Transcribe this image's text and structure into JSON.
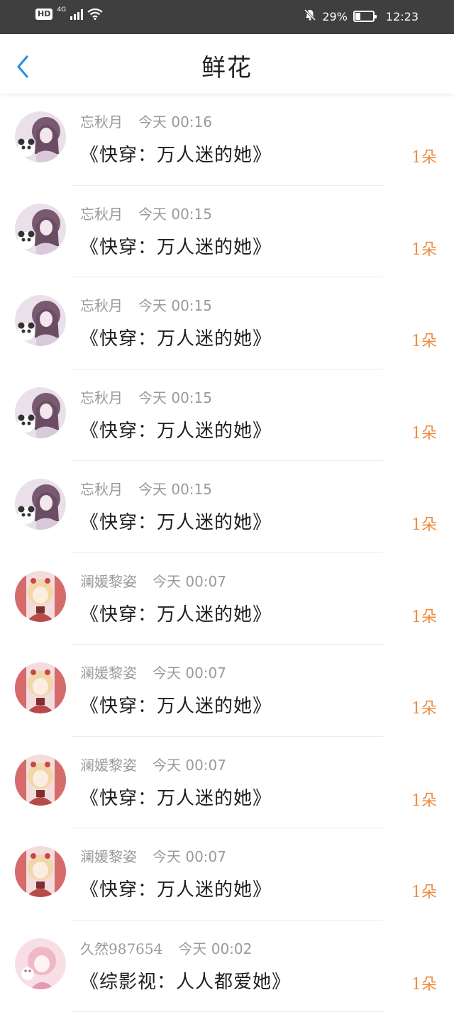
{
  "status_bar": {
    "hd": "HD",
    "network": "4G",
    "battery_text": "29%",
    "battery_level": 0.29,
    "time": "12:23"
  },
  "header": {
    "title": "鲜花"
  },
  "records": [
    {
      "user": "忘秋月",
      "time": "今天 00:16",
      "book": "《快穿：万人迷的她》",
      "amount": "1朵",
      "avatar": "purple"
    },
    {
      "user": "忘秋月",
      "time": "今天 00:15",
      "book": "《快穿：万人迷的她》",
      "amount": "1朵",
      "avatar": "purple"
    },
    {
      "user": "忘秋月",
      "time": "今天 00:15",
      "book": "《快穿：万人迷的她》",
      "amount": "1朵",
      "avatar": "purple"
    },
    {
      "user": "忘秋月",
      "time": "今天 00:15",
      "book": "《快穿：万人迷的她》",
      "amount": "1朵",
      "avatar": "purple"
    },
    {
      "user": "忘秋月",
      "time": "今天 00:15",
      "book": "《快穿：万人迷的她》",
      "amount": "1朵",
      "avatar": "purple"
    },
    {
      "user": "澜媛黎姿",
      "time": "今天 00:07",
      "book": "《快穿：万人迷的她》",
      "amount": "1朵",
      "avatar": "pinkred"
    },
    {
      "user": "澜媛黎姿",
      "time": "今天 00:07",
      "book": "《快穿：万人迷的她》",
      "amount": "1朵",
      "avatar": "pinkred"
    },
    {
      "user": "澜媛黎姿",
      "time": "今天 00:07",
      "book": "《快穿：万人迷的她》",
      "amount": "1朵",
      "avatar": "pinkred"
    },
    {
      "user": "澜媛黎姿",
      "time": "今天 00:07",
      "book": "《快穿：万人迷的她》",
      "amount": "1朵",
      "avatar": "pinkred"
    },
    {
      "user": "久然987654",
      "time": "今天 00:02",
      "book": "《综影视：人人都爱她》",
      "amount": "1朵",
      "avatar": "pinksoft"
    }
  ],
  "colors": {
    "accent_back": "#2b8fe6",
    "amount": "#f08a3c",
    "meta_text": "#9a9a9a",
    "status_bar_bg": "#3f3f3f"
  },
  "icons": {
    "back": "chevron-left-icon",
    "wifi": "wifi-icon",
    "mute": "bell-off-icon",
    "battery": "battery-icon"
  }
}
